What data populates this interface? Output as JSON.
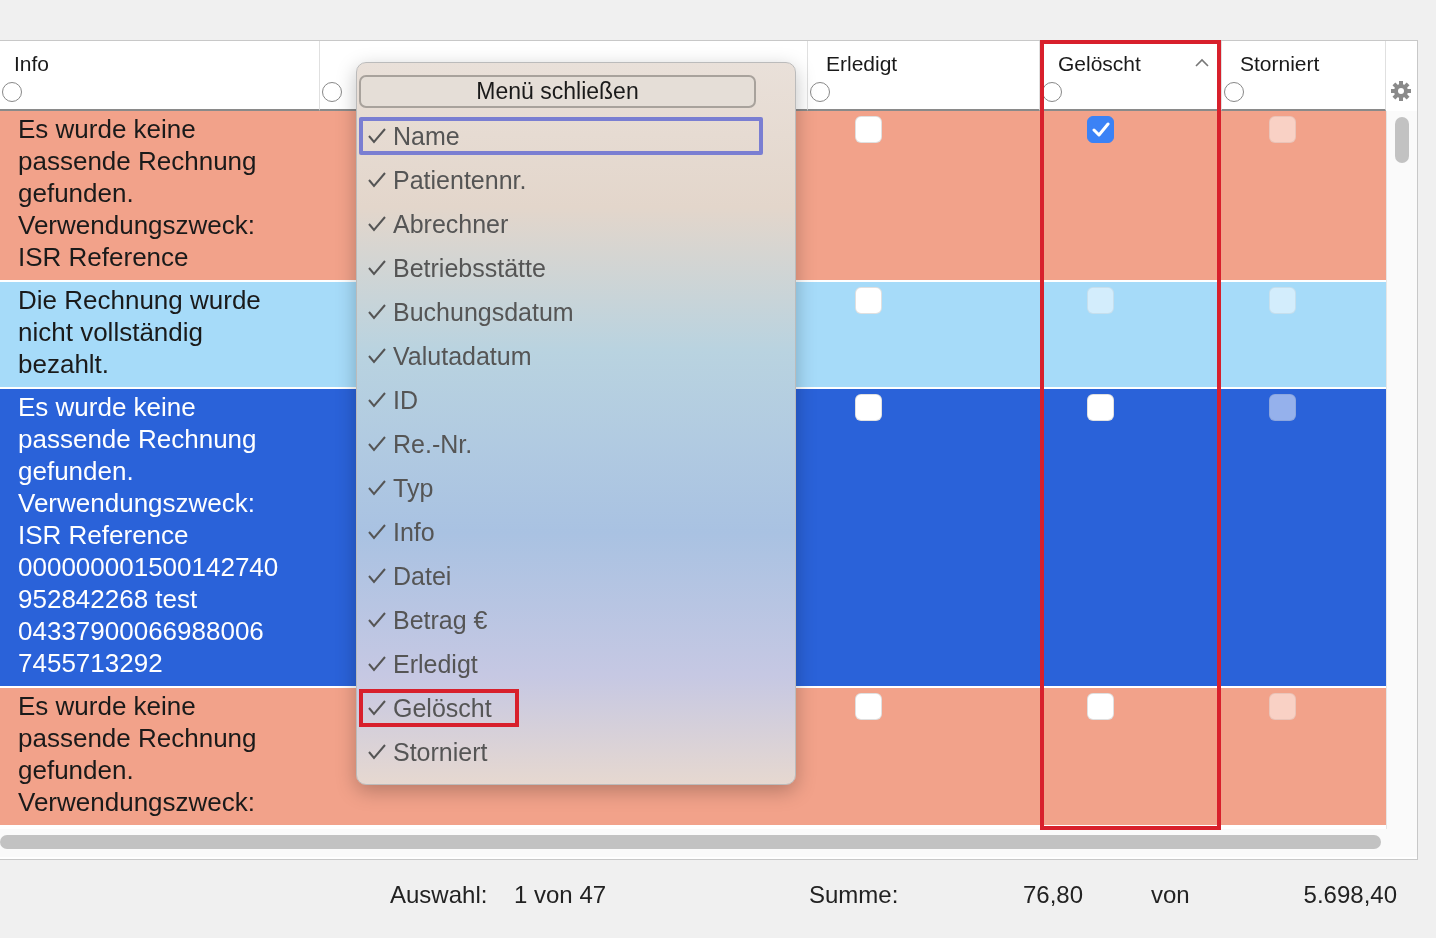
{
  "table": {
    "columns": [
      {
        "label": "Info",
        "selected": false,
        "sorted": false,
        "highlighted": false
      },
      {
        "selected": false,
        "sorted": false,
        "highlighted": false
      },
      {
        "label": "Erledigt",
        "selected": false,
        "sorted": false,
        "highlighted": false
      },
      {
        "label": "Gelöscht",
        "selected": false,
        "sorted": true,
        "highlighted": true
      },
      {
        "label": "Storniert",
        "selected": false,
        "sorted": false,
        "highlighted": false
      }
    ],
    "rows": [
      {
        "color": "#f2a28a",
        "selected": false,
        "info": "Es wurde keine passende Rechnung gefunden. Verwendungszweck: ISR Reference",
        "erledigt": {
          "checked": false,
          "disabled": false
        },
        "geloescht": {
          "checked": true,
          "disabled": false
        },
        "storniert": {
          "checked": false,
          "disabled": true
        }
      },
      {
        "color": "#a6dbf9",
        "selected": false,
        "info": "Die Rechnung wurde nicht vollständig bezahlt.",
        "erledigt": {
          "checked": false,
          "disabled": false
        },
        "geloescht": {
          "checked": false,
          "disabled": true
        },
        "storniert": {
          "checked": false,
          "disabled": true
        }
      },
      {
        "color": "#2a62d9",
        "selected": true,
        "info": "Es wurde keine passende Rechnung gefunden. Verwendungszweck: ISR Reference 000000001500142740 952842268 test 04337900066988006 7455713292",
        "erledigt": {
          "checked": false,
          "disabled": false
        },
        "geloescht": {
          "checked": false,
          "disabled": false
        },
        "storniert": {
          "checked": false,
          "disabled": true
        }
      },
      {
        "color": "#f2a28a",
        "selected": false,
        "info": "Es wurde keine passende Rechnung gefunden. Verwendungszweck:",
        "erledigt": {
          "checked": false,
          "disabled": false
        },
        "geloescht": {
          "checked": false,
          "disabled": false
        },
        "storniert": {
          "checked": false,
          "disabled": true
        }
      }
    ]
  },
  "column_menu": {
    "close_button": "Menü schließen",
    "items": [
      {
        "label": "Name",
        "checked": true,
        "focused": true,
        "highlighted": false
      },
      {
        "label": "Patientennr.",
        "checked": true,
        "focused": false,
        "highlighted": false
      },
      {
        "label": "Abrechner",
        "checked": true,
        "focused": false,
        "highlighted": false
      },
      {
        "label": "Betriebsstätte",
        "checked": true,
        "focused": false,
        "highlighted": false
      },
      {
        "label": "Buchungsdatum",
        "checked": true,
        "focused": false,
        "highlighted": false
      },
      {
        "label": "Valutadatum",
        "checked": true,
        "focused": false,
        "highlighted": false
      },
      {
        "label": "ID",
        "checked": true,
        "focused": false,
        "highlighted": false
      },
      {
        "label": "Re.-Nr.",
        "checked": true,
        "focused": false,
        "highlighted": false
      },
      {
        "label": "Typ",
        "checked": true,
        "focused": false,
        "highlighted": false
      },
      {
        "label": "Info",
        "checked": true,
        "focused": false,
        "highlighted": false
      },
      {
        "label": "Datei",
        "checked": true,
        "focused": false,
        "highlighted": false
      },
      {
        "label": "Betrag €",
        "checked": true,
        "focused": false,
        "highlighted": false
      },
      {
        "label": "Erledigt",
        "checked": true,
        "focused": false,
        "highlighted": false
      },
      {
        "label": "Gelöscht",
        "checked": true,
        "focused": false,
        "highlighted": true
      },
      {
        "label": "Storniert",
        "checked": true,
        "focused": false,
        "highlighted": false
      }
    ]
  },
  "status_bar": {
    "selection_label": "Auswahl:",
    "selection_value": "1 von 47",
    "sum_label": "Summe:",
    "sum_value": "76,80",
    "of_label": "von",
    "total_value": "5.698,40"
  }
}
